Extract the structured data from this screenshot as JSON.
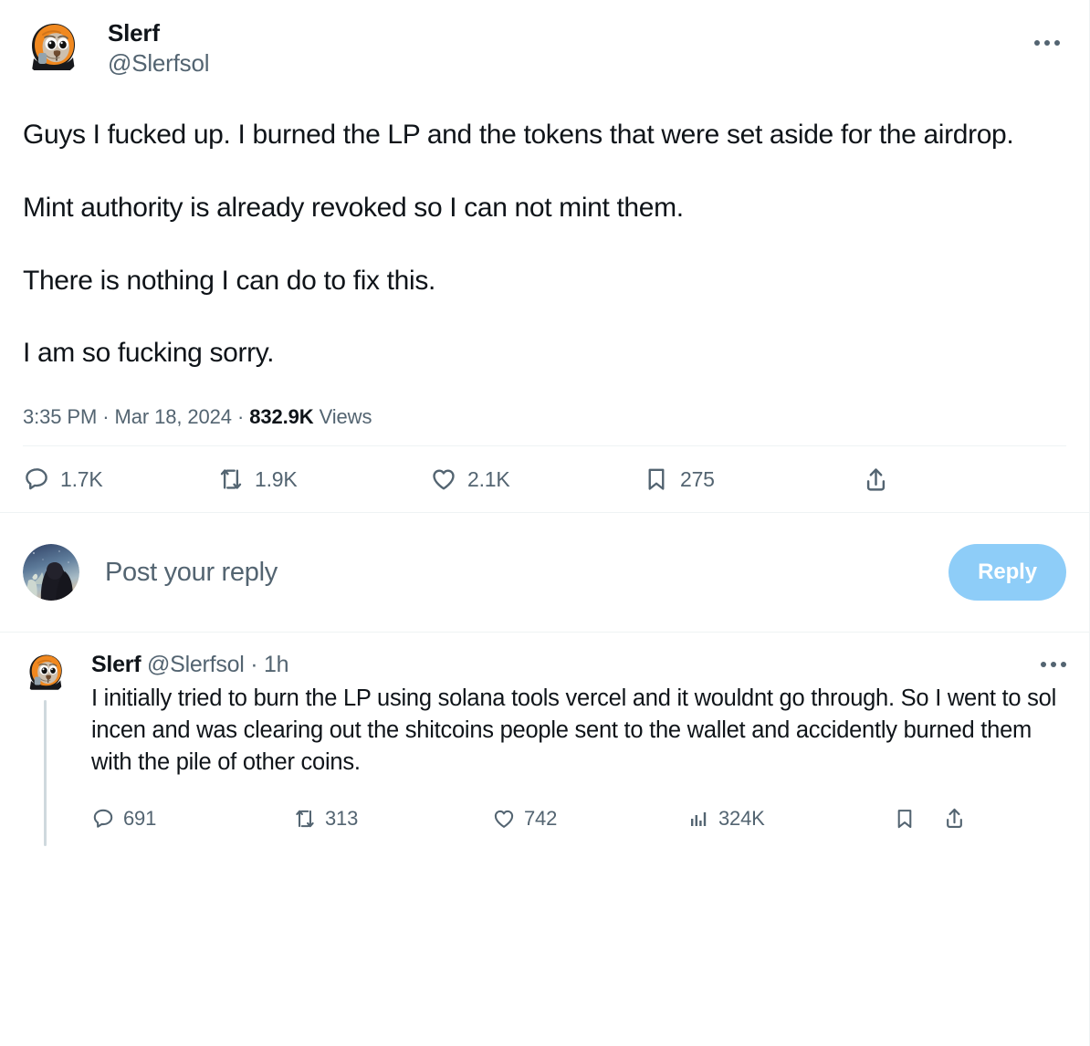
{
  "main_post": {
    "display_name": "Slerf",
    "handle": "@Slerfsol",
    "avatar_alt": "slerf-sloth-avatar",
    "more_menu": "more-options",
    "text": "Guys I fucked up. I burned the LP and the tokens that were set aside for the airdrop.\n\nMint authority is already revoked so I can not mint them.\n\nThere is nothing I can do to fix this.\n\nI am so fucking sorry.",
    "time": "3:35 PM",
    "date": "Mar 18, 2024",
    "views_count": "832.9K",
    "views_label": "Views",
    "dot_sep": "·",
    "actions": {
      "replies": "1.7K",
      "reposts": "1.9K",
      "likes": "2.1K",
      "bookmarks": "275",
      "share": ""
    }
  },
  "composer": {
    "placeholder": "Post your reply",
    "reply_label": "Reply",
    "avatar_alt": "user-photo-avatar"
  },
  "reply_post": {
    "display_name": "Slerf",
    "handle": "@Slerfsol",
    "separator": "·",
    "age": "1h",
    "text": "I initially tried to burn the LP using solana tools vercel and it wouldnt go through. So I went to sol incen and was clearing out the shitcoins people sent to the wallet and accidently burned them with the pile of other coins.",
    "actions": {
      "replies": "691",
      "reposts": "313",
      "likes": "742",
      "views": "324K"
    }
  },
  "colors": {
    "text_primary": "#0f1419",
    "text_secondary": "#536471",
    "divider": "#eff3f4",
    "reply_button": "#8ecdf8",
    "thread_line": "#cfd9de",
    "accent_orange": "#f08a24"
  }
}
